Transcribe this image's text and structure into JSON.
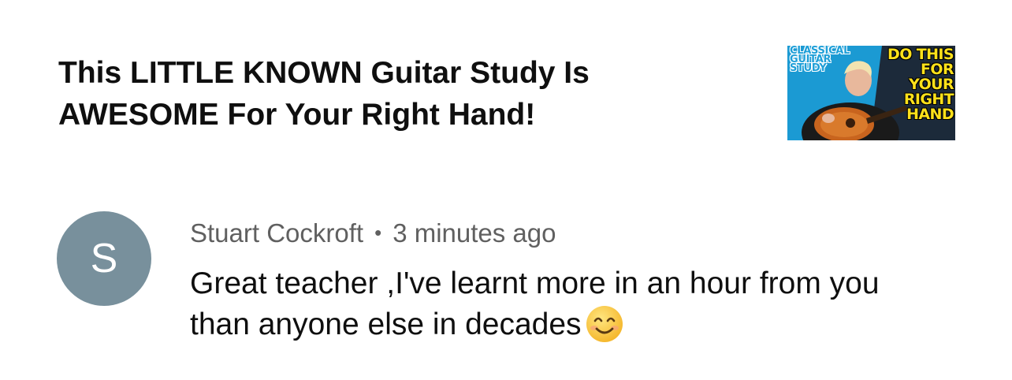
{
  "video": {
    "title": "This LITTLE KNOWN Guitar Study Is AWESOME For Your Right Hand!",
    "thumbnail": {
      "overlay_left": "CLASSICAL GUITAR STUDY",
      "overlay_right": "DO THIS FOR YOUR RIGHT HAND"
    }
  },
  "comment": {
    "avatar_letter": "S",
    "avatar_color": "#78909c",
    "author": "Stuart Cockroft",
    "separator": "•",
    "timestamp": "3 minutes ago",
    "text": "Great teacher ,I've learnt more in an hour from you than anyone else in decades",
    "emoji": "smiling-face-with-smiling-eyes"
  }
}
